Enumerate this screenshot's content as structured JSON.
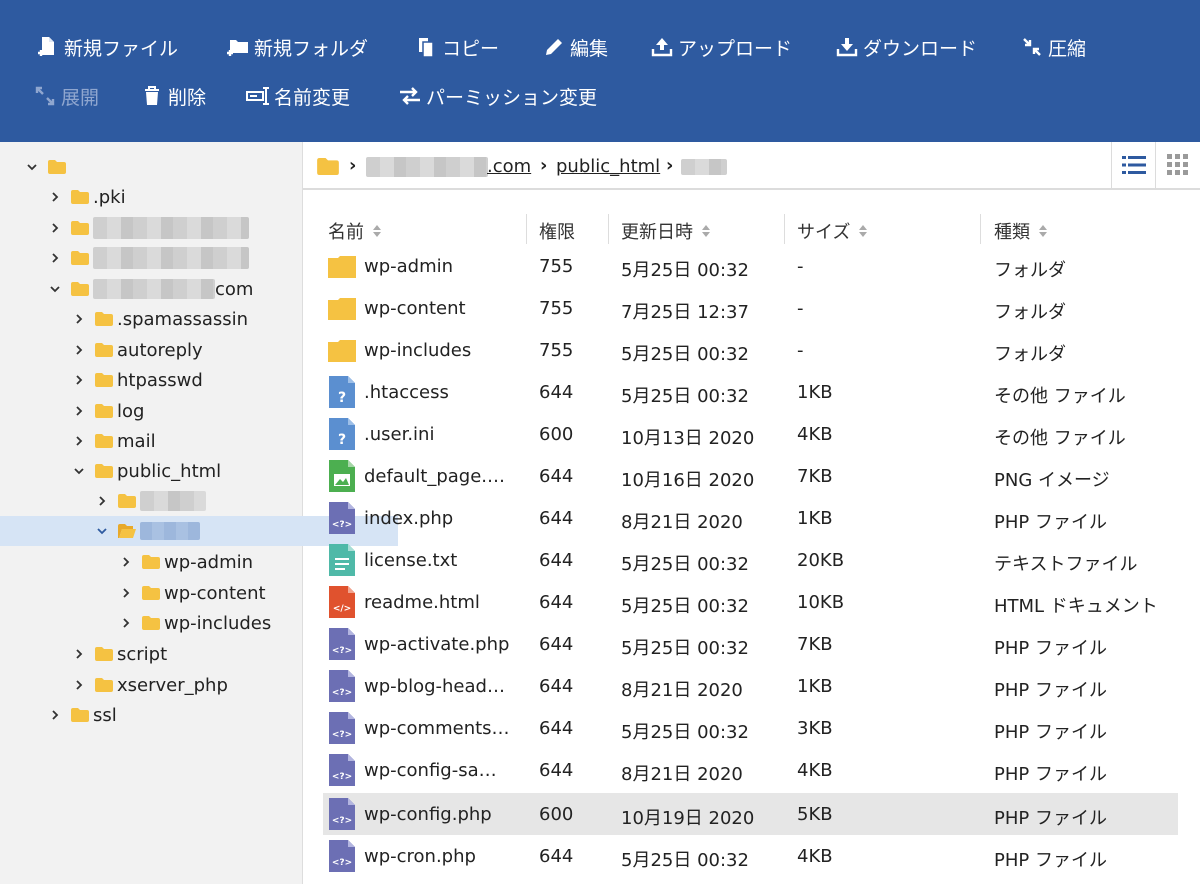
{
  "toolbar": {
    "new_file": "新規ファイル",
    "new_folder": "新規フォルダ",
    "copy": "コピー",
    "edit": "編集",
    "upload": "アップロード",
    "download": "ダウンロード",
    "compress": "圧縮",
    "extract": "展開",
    "delete": "削除",
    "rename": "名前変更",
    "permission": "パーミッション変更"
  },
  "tree": {
    "pki": ".pki",
    "domain_suffix": "com",
    "spamassassin": ".spamassassin",
    "autoreply": "autoreply",
    "htpasswd": "htpasswd",
    "log": "log",
    "mail": "mail",
    "public_html": "public_html",
    "wp_admin": "wp-admin",
    "wp_content": "wp-content",
    "wp_includes": "wp-includes",
    "script": "script",
    "xserver_php": "xserver_php",
    "ssl": "ssl"
  },
  "breadcrumb": {
    "domain_suffix": ".com",
    "public_html": "public_html"
  },
  "columns": {
    "name": "名前",
    "permission": "権限",
    "modified": "更新日時",
    "size": "サイズ",
    "type": "種類"
  },
  "files": [
    {
      "name": "wp-admin",
      "perm": "755",
      "date": "5月25日 00:32",
      "size": "-",
      "type": "フォルダ"
    },
    {
      "name": "wp-content",
      "perm": "755",
      "date": "7月25日 12:37",
      "size": "-",
      "type": "フォルダ"
    },
    {
      "name": "wp-includes",
      "perm": "755",
      "date": "5月25日 00:32",
      "size": "-",
      "type": "フォルダ"
    },
    {
      "name": ".htaccess",
      "perm": "644",
      "date": "5月25日 00:32",
      "size": "1KB",
      "type": "その他 ファイル"
    },
    {
      "name": ".user.ini",
      "perm": "600",
      "date": "10月13日 2020",
      "size": "4KB",
      "type": "その他 ファイル"
    },
    {
      "name": "default_page.png",
      "perm": "644",
      "date": "10月16日 2020",
      "size": "7KB",
      "type": "PNG イメージ"
    },
    {
      "name": "index.php",
      "perm": "644",
      "date": "8月21日 2020",
      "size": "1KB",
      "type": "PHP ファイル"
    },
    {
      "name": "license.txt",
      "perm": "644",
      "date": "5月25日 00:32",
      "size": "20KB",
      "type": "テキストファイル"
    },
    {
      "name": "readme.html",
      "perm": "644",
      "date": "5月25日 00:32",
      "size": "10KB",
      "type": "HTML ドキュメント"
    },
    {
      "name": "wp-activate.php",
      "perm": "644",
      "date": "5月25日 00:32",
      "size": "7KB",
      "type": "PHP ファイル"
    },
    {
      "name": "wp-blog-heade…",
      "perm": "644",
      "date": "8月21日 2020",
      "size": "1KB",
      "type": "PHP ファイル"
    },
    {
      "name": "wp-comments-…",
      "perm": "644",
      "date": "5月25日 00:32",
      "size": "3KB",
      "type": "PHP ファイル"
    },
    {
      "name": "wp-config-sam…",
      "perm": "644",
      "date": "8月21日 2020",
      "size": "4KB",
      "type": "PHP ファイル"
    },
    {
      "name": "wp-config.php",
      "perm": "600",
      "date": "10月19日 2020",
      "size": "5KB",
      "type": "PHP ファイル"
    },
    {
      "name": "wp-cron.php",
      "perm": "644",
      "date": "5月25日 00:32",
      "size": "4KB",
      "type": "PHP ファイル"
    }
  ],
  "colors": {
    "toolbar": "#2e5aa0",
    "folder": "#f5c242",
    "selected_tree": "#d6e4f5",
    "php_icon": "#6c6fb4",
    "txt_icon": "#4fb9a8",
    "html_icon": "#e0522e",
    "png_icon": "#4caf50",
    "other_icon": "#5b8fd0"
  }
}
